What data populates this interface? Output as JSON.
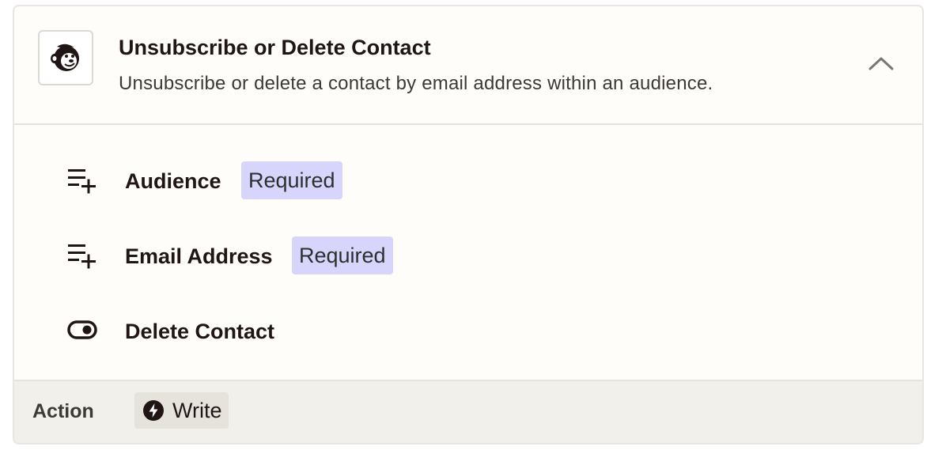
{
  "step": {
    "title": "Unsubscribe or Delete Contact",
    "description": "Unsubscribe or delete a contact by email address within an audience.",
    "app_icon": "mailchimp-logo",
    "collapse_icon": "chevron-up-icon"
  },
  "fields": [
    {
      "label": "Audience",
      "badge": "Required",
      "icon": "list-add-icon"
    },
    {
      "label": "Email Address",
      "badge": "Required",
      "icon": "list-add-icon"
    },
    {
      "label": "Delete Contact",
      "icon": "toggle-icon"
    }
  ],
  "footer": {
    "label": "Action",
    "chip_label": "Write",
    "chip_icon": "lightning-bolt-icon"
  },
  "colors": {
    "badge_bg": "#d7d5fb",
    "footer_bg": "#f2f0eb",
    "card_bg": "#fffdf9"
  }
}
